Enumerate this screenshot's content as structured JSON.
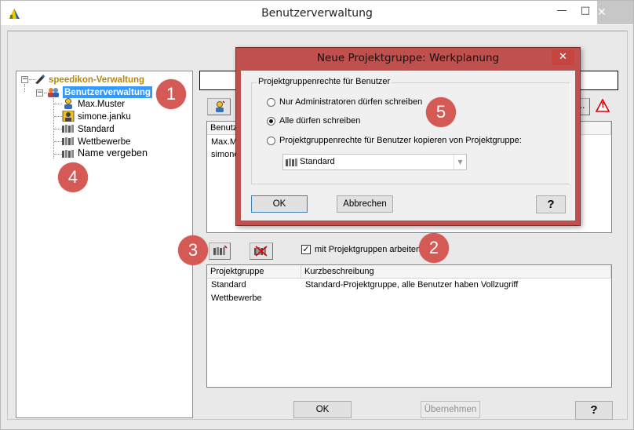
{
  "window": {
    "title": "Benutzerverwaltung",
    "minimize": "—",
    "maximize": "□",
    "close": "✕"
  },
  "tree": {
    "root": "speedikon-Verwaltung",
    "node": "Benutzerverwaltung",
    "users": [
      "Max.Muster",
      "simone.janku"
    ],
    "groups": [
      "Standard",
      "Wettbewerbe"
    ],
    "new_item": "Name vergeben"
  },
  "toolbar": {
    "more": "..",
    "warning": "!"
  },
  "users_table": {
    "header": "Benutz",
    "rows": [
      "Max.M",
      "simone"
    ]
  },
  "groups_section": {
    "checkbox_label": "mit Projektgruppen arbeiten",
    "checkbox_mark": "✓",
    "columns": [
      "Projektgruppe",
      "Kurzbeschreibung"
    ],
    "rows": [
      {
        "name": "Standard",
        "desc": "Standard-Projektgruppe, alle Benutzer haben Vollzugriff"
      },
      {
        "name": "Wettbewerbe",
        "desc": ""
      }
    ]
  },
  "footer": {
    "ok": "OK",
    "apply": "Übernehmen",
    "help": "?"
  },
  "dialog": {
    "title": "Neue Projektgruppe:  Werkplanung",
    "close": "✕",
    "group_legend": "Projektgruppenrechte für Benutzer",
    "options": [
      "Nur Administratoren dürfen schreiben",
      "Alle dürfen schreiben",
      "Projektgruppenrechte für Benutzer kopieren von Projektgruppe:"
    ],
    "selected_option": 1,
    "combo_value": "Standard",
    "ok": "OK",
    "cancel": "Abbrechen",
    "help": "?"
  },
  "badges": [
    "1",
    "2",
    "3",
    "4",
    "5"
  ],
  "colors": {
    "badge": "#d55a55",
    "dialog_frame": "#c0504d",
    "tree_root": "#b8860b",
    "tree_selected": "#3399ff"
  }
}
